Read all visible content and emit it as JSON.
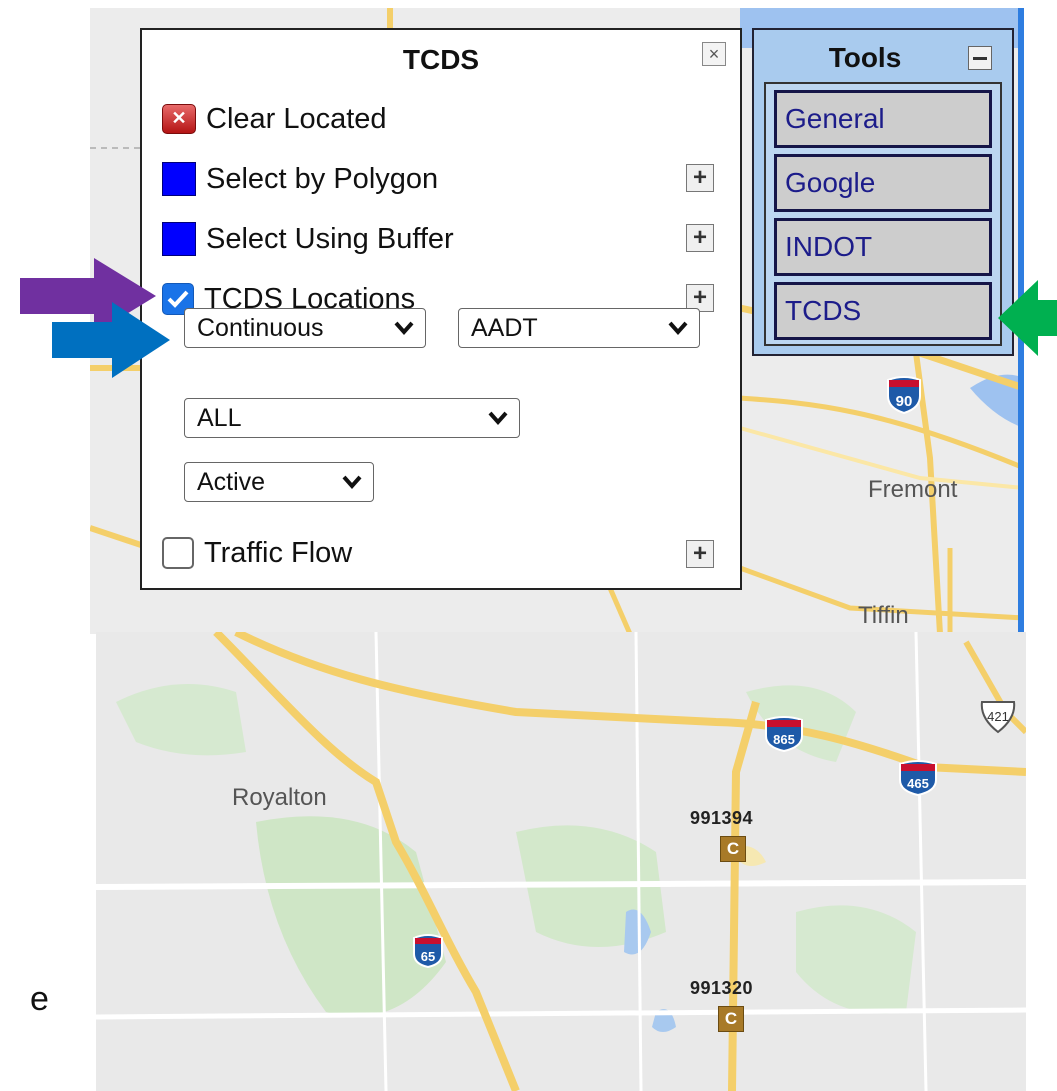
{
  "tcds_panel": {
    "title": "TCDS",
    "rows": {
      "clear_located": "Clear Located",
      "select_polygon": "Select by Polygon",
      "select_buffer": "Select Using Buffer",
      "tcds_locations": "TCDS Locations",
      "traffic_flow": "Traffic Flow"
    },
    "tcds_locations_checked": true,
    "traffic_flow_checked": false,
    "selects": {
      "type": "Continuous",
      "measure": "AADT",
      "scope": "ALL",
      "status": "Active"
    }
  },
  "tools_panel": {
    "title": "Tools",
    "buttons": [
      "General",
      "Google",
      "INDOT",
      "TCDS"
    ]
  },
  "top_map": {
    "places": [
      "Fremont",
      "Tiffin"
    ],
    "partial_place": "nan",
    "shields": [
      "90"
    ]
  },
  "bottom_map": {
    "places": [
      "Royalton"
    ],
    "shields": [
      "865",
      "465",
      "421",
      "65"
    ],
    "markers": [
      {
        "label": "991394",
        "symbol": "C"
      },
      {
        "label": "991320",
        "symbol": "C"
      }
    ]
  },
  "page_fragment": "e",
  "arrow_colors": {
    "purple": "#7030a0",
    "blue": "#0070c0",
    "green": "#00b050"
  },
  "icons": [
    "close-icon",
    "plus-icon",
    "minus-icon",
    "checkmark-icon",
    "chevron-down-icon",
    "clear-x-icon"
  ]
}
